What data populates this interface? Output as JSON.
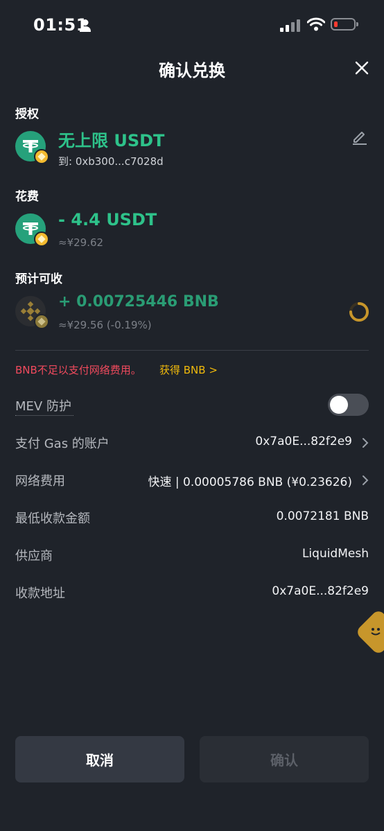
{
  "status_bar": {
    "time": "01:51"
  },
  "header": {
    "title": "确认兑换"
  },
  "authorize": {
    "label": "授权",
    "amount": "无上限 USDT",
    "to": "到: 0xb300...c7028d"
  },
  "spend": {
    "label": "花费",
    "amount": "- 4.4 USDT",
    "fiat": "≈¥29.62"
  },
  "receive": {
    "label": "预计可收",
    "amount": "+ 0.00725446 BNB",
    "fiat": "≈¥29.56 (-0.19%)"
  },
  "warning": {
    "text": "BNB不足以支付网络费用。",
    "link": "获得 BNB >"
  },
  "mev": {
    "label": "MEV 防护",
    "enabled": false
  },
  "details": {
    "gas_account_label": "支付 Gas 的账户",
    "gas_account_value": "0x7a0E...82f2e9",
    "network_fee_label": "网络费用",
    "network_fee_value": "快速 | 0.00005786 BNB (¥0.23626)",
    "min_receive_label": "最低收款金额",
    "min_receive_value": "0.0072181 BNB",
    "provider_label": "供应商",
    "provider_value": "LiquidMesh",
    "receive_addr_label": "收款地址",
    "receive_addr_value": "0x7a0E...82f2e9"
  },
  "buttons": {
    "cancel": "取消",
    "confirm": "确认"
  },
  "colors": {
    "green": "#2ec28a",
    "warning_red": "#f04a5d",
    "link_yellow": "#f0b90b"
  }
}
